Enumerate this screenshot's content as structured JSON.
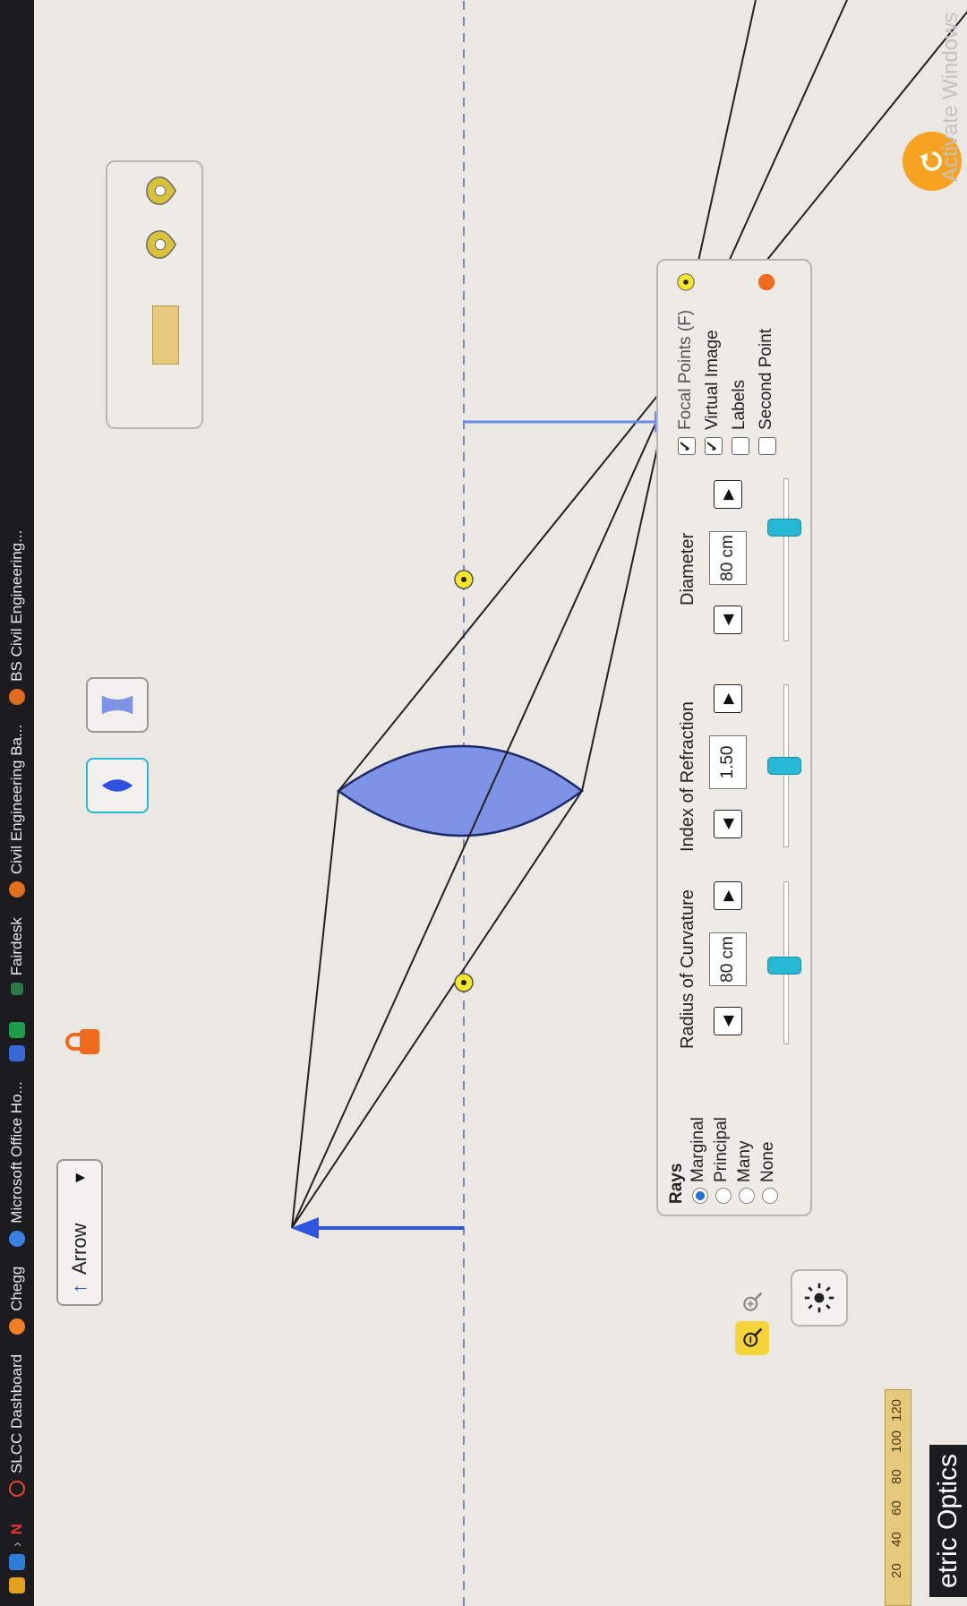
{
  "bookmarks": [
    {
      "label": "SLCC Dashboard",
      "color": "#e24a2c"
    },
    {
      "label": "Chegg",
      "color": "#f07f24"
    },
    {
      "label": "Microsoft Office Ho...",
      "color": "#3b82e0"
    },
    {
      "label": "Fairdesk",
      "color": "#1e9c4c"
    },
    {
      "label": "Civil Engineering Ba...",
      "color": "#e0701e"
    },
    {
      "label": "BS Civil Engineering...",
      "color": "#e06b1e"
    }
  ],
  "top_toolbar": {
    "object_selector": {
      "selected": "Arrow"
    },
    "lens_types": [
      {
        "name": "convex",
        "selected": true
      },
      {
        "name": "concave",
        "selected": false
      }
    ],
    "tools": [
      "ruler-icon",
      "focal-marker-icon",
      "second-point-marker-icon"
    ]
  },
  "sim": {
    "title_partial": "etric Optics",
    "activate_windows_text": "Activate Windows",
    "ruler_ticks": [
      "20",
      "40",
      "60",
      "80",
      "100",
      "120"
    ],
    "colors": {
      "lens": "#7f93e6",
      "arrow": "#2d55e0",
      "axis": "#7a87c6",
      "focal": "#f5e62a"
    }
  },
  "controls": {
    "rays": {
      "title": "Rays",
      "options": [
        {
          "label": "Marginal",
          "selected": true
        },
        {
          "label": "Principal",
          "selected": false
        },
        {
          "label": "Many",
          "selected": false
        },
        {
          "label": "None",
          "selected": false
        }
      ]
    },
    "radius": {
      "label": "Radius of Curvature",
      "value": "80 cm",
      "slider_fraction": 0.45
    },
    "index": {
      "label": "Index of Refraction",
      "value": "1.50",
      "slider_fraction": 0.5
    },
    "diameter": {
      "label": "Diameter",
      "value": "80 cm",
      "slider_fraction": 0.7
    },
    "checks": [
      {
        "label": "Focal Points (F)",
        "checked": true,
        "marker_color": "#f5e62a"
      },
      {
        "label": "Virtual Image",
        "checked": true
      },
      {
        "label": "Labels",
        "checked": false
      },
      {
        "label": "Second Point",
        "checked": false,
        "marker_color": "#f06a1e"
      }
    ]
  }
}
